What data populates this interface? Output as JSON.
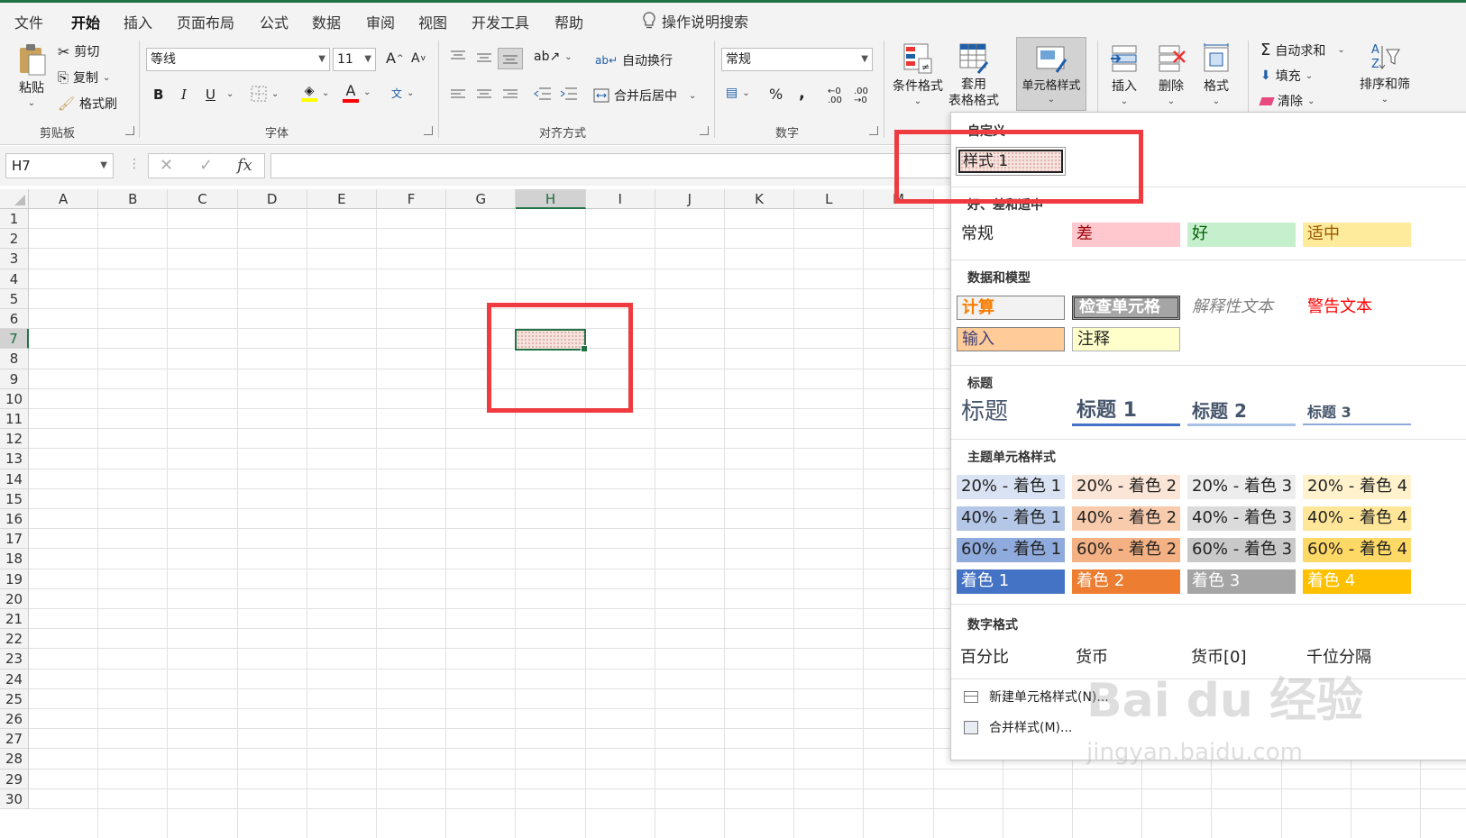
{
  "tabs": [
    "文件",
    "开始",
    "插入",
    "页面布局",
    "公式",
    "数据",
    "审阅",
    "视图",
    "开发工具",
    "帮助"
  ],
  "search_label": "操作说明搜索",
  "clipboard": {
    "paste": "粘贴",
    "cut": "剪切",
    "copy": "复制",
    "format_painter": "格式刷",
    "label": "剪贴板"
  },
  "font": {
    "name": "等线",
    "size": "11",
    "bold": "B",
    "italic": "I",
    "underline": "U",
    "label": "字体",
    "grow": "A",
    "shrink": "A",
    "color_letter": "A"
  },
  "alignment": {
    "wrap": "自动换行",
    "merge": "合并后居中",
    "label": "对齐方式"
  },
  "number": {
    "format": "常规",
    "percent": "%",
    "comma": ",",
    "label": "数字"
  },
  "styles": {
    "conditional": "条件格式",
    "table_line1": "套用",
    "table_line2": "表格格式",
    "cell_styles": "单元格样式"
  },
  "cells": {
    "insert": "插入",
    "delete": "删除",
    "format": "格式"
  },
  "editing": {
    "autosum": "自动求和",
    "fill": "填充",
    "clear": "清除",
    "sort": "排序和筛"
  },
  "namebox": "H7",
  "fx": "fx",
  "columns": [
    "A",
    "B",
    "C",
    "D",
    "E",
    "F",
    "G",
    "H",
    "I",
    "J",
    "K",
    "L",
    "M"
  ],
  "rows": [
    "1",
    "2",
    "3",
    "4",
    "5",
    "6",
    "7",
    "8",
    "9",
    "10",
    "11",
    "12",
    "13",
    "14",
    "15",
    "16",
    "17",
    "18",
    "19",
    "20",
    "21",
    "22",
    "23",
    "24",
    "25",
    "26",
    "27",
    "28",
    "29",
    "30"
  ],
  "gallery": {
    "custom_title": "自定义",
    "custom_style": "样式 1",
    "good_bad_title": "好、差和适中",
    "normal": "常规",
    "bad": "差",
    "good": "好",
    "neutral": "适中",
    "data_model_title": "数据和模型",
    "calc": "计算",
    "check_cell": "检查单元格",
    "explanatory": "解释性文本",
    "warning": "警告文本",
    "input": "输入",
    "note": "注释",
    "title_section": "标题",
    "title": "标题",
    "heading1": "标题 1",
    "heading2": "标题 2",
    "heading3": "标题 3",
    "theme_title": "主题单元格样式",
    "theme_rows": [
      [
        "20% - 着色 1",
        "20% - 着色 2",
        "20% - 着色 3",
        "20% - 着色 4"
      ],
      [
        "40% - 着色 1",
        "40% - 着色 2",
        "40% - 着色 3",
        "40% - 着色 4"
      ],
      [
        "60% - 着色 1",
        "60% - 着色 2",
        "60% - 着色 3",
        "60% - 着色 4"
      ],
      [
        "着色 1",
        "着色 2",
        "着色 3",
        "着色 4"
      ]
    ],
    "number_title": "数字格式",
    "percent": "百分比",
    "currency": "货币",
    "currency0": "货币[0]",
    "thousands": "千位分隔",
    "new_style": "新建单元格样式(N)...",
    "merge_styles": "合并样式(M)..."
  },
  "watermark": "Bai du 经验",
  "watermark_url": "jingyan.baidu.com",
  "colors": {
    "accent": "#217346",
    "highlight": "#ef3b3f"
  }
}
